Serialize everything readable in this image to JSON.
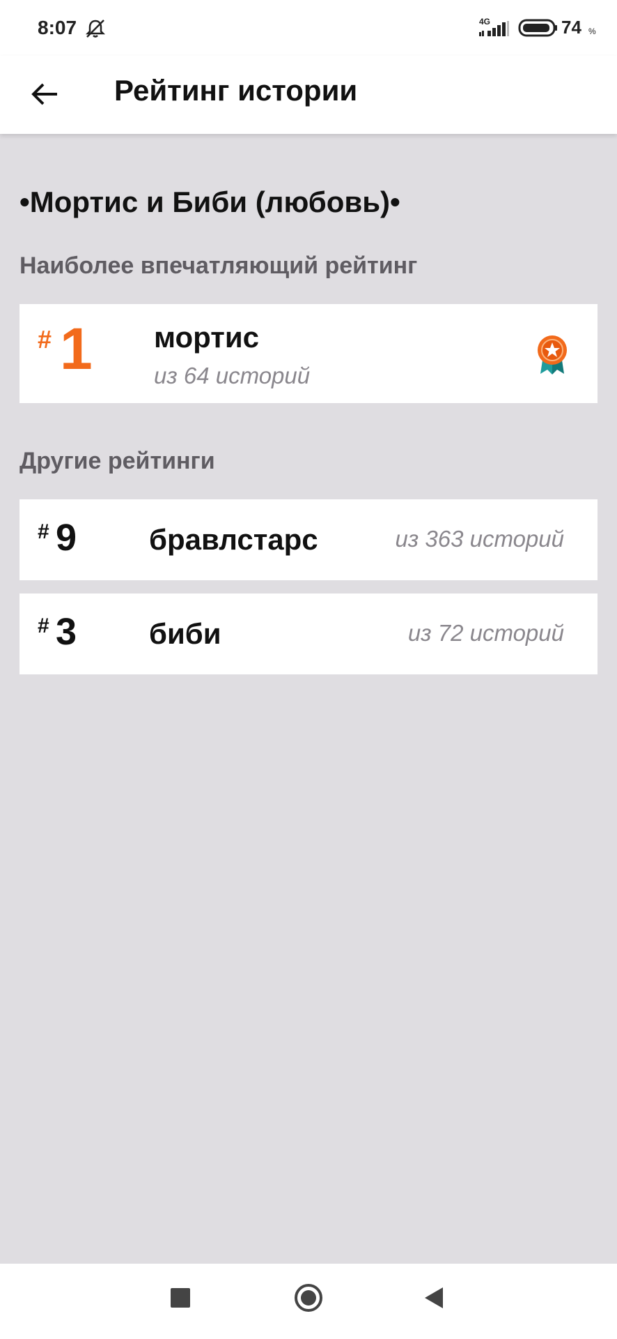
{
  "status_bar": {
    "time": "8:07",
    "network": "4G",
    "battery": "74",
    "battery_unit": "%"
  },
  "app_bar": {
    "title": "Рейтинг истории"
  },
  "story": {
    "title": "•Мортис и Биби (любовь)•"
  },
  "top_rating": {
    "section_label": "Наиболее впечатляющий рейтинг",
    "hash": "#",
    "rank": "1",
    "tag": "мортис",
    "count": "из 64 историй"
  },
  "other_ratings": {
    "section_label": "Другие рейтинги",
    "items": [
      {
        "hash": "#",
        "rank": "9",
        "tag": "бравлстарс",
        "count": "из 363 историй"
      },
      {
        "hash": "#",
        "rank": "3",
        "tag": "биби",
        "count": "из 72 историй"
      }
    ]
  },
  "colors": {
    "accent": "#f26a1b",
    "background": "#dfdde1",
    "card": "#ffffff",
    "muted_text": "#8a878d",
    "section_text": "#5f5c62"
  },
  "icons": {
    "back": "arrow-left-icon",
    "medal": "medal-icon",
    "mute": "bell-off-icon",
    "nav_recent": "square-icon",
    "nav_home": "circle-icon",
    "nav_back": "triangle-back-icon"
  }
}
